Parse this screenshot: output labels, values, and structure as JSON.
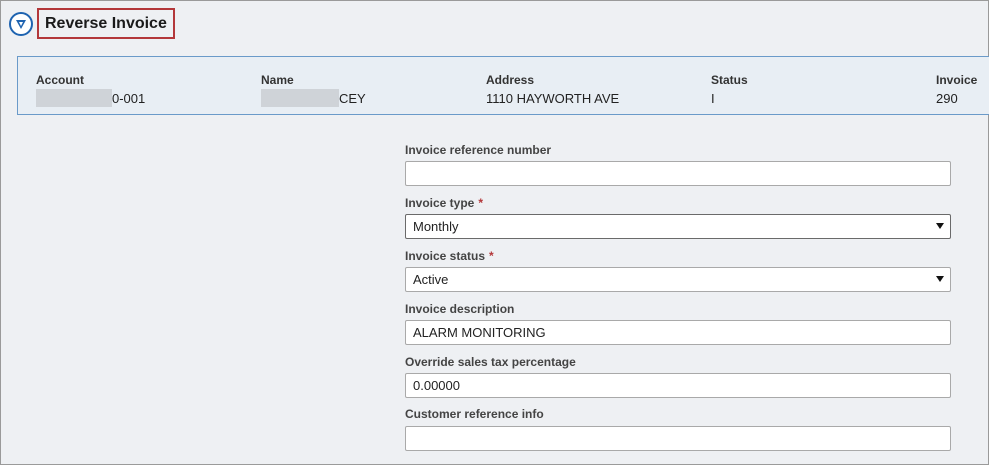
{
  "header": {
    "title": "Reverse Invoice",
    "back_icon": "back-arrow-circle-icon"
  },
  "info": {
    "account_label": "Account",
    "account_value": "0-001",
    "name_label": "Name",
    "name_value": "CEY",
    "address_label": "Address",
    "address_value": "1110 HAYWORTH AVE",
    "status_label": "Status",
    "status_value": "I",
    "invoice_label": "Invoice",
    "invoice_value": "290"
  },
  "form": {
    "ref_number_label": "Invoice reference number",
    "ref_number_value": "",
    "type_label": "Invoice type",
    "type_value": "Monthly",
    "status_label": "Invoice status",
    "status_value": "Active",
    "description_label": "Invoice description",
    "description_value": "ALARM MONITORING",
    "tax_label": "Override sales tax percentage",
    "tax_value": "0.00000",
    "customer_ref_label": "Customer reference info",
    "customer_ref_value": "",
    "required_mark": "*"
  },
  "colors": {
    "accent": "#1e63b0",
    "highlight_border": "#b3373a",
    "panel_background": "#e8eef4"
  }
}
